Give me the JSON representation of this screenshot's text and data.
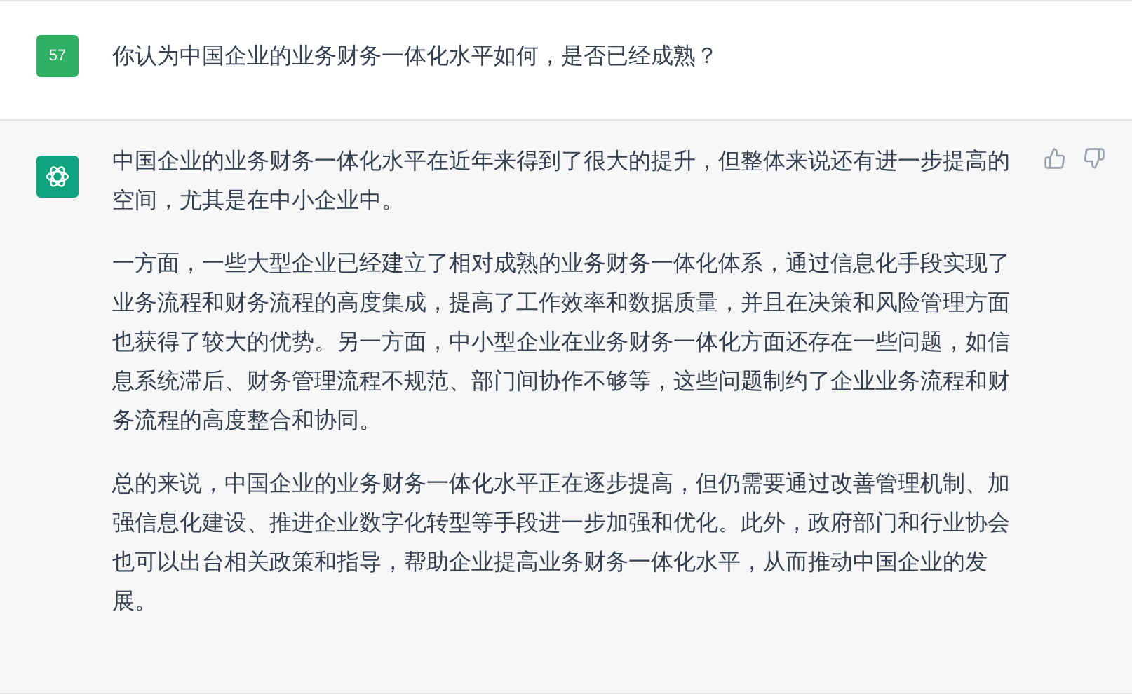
{
  "question": {
    "avatar": "57",
    "text": "你认为中国企业的业务财务一体化水平如何，是否已经成熟？"
  },
  "answer": {
    "paragraphs": [
      "中国企业的业务财务一体化水平在近年来得到了很大的提升，但整体来说还有进一步提高的空间，尤其是在中小企业中。",
      "一方面，一些大型企业已经建立了相对成熟的业务财务一体化体系，通过信息化手段实现了业务流程和财务流程的高度集成，提高了工作效率和数据质量，并且在决策和风险管理方面也获得了较大的优势。另一方面，中小型企业在业务财务一体化方面还存在一些问题，如信息系统滞后、财务管理流程不规范、部门间协作不够等，这些问题制约了企业业务流程和财务流程的高度整合和协同。",
      "总的来说，中国企业的业务财务一体化水平正在逐步提高，但仍需要通过改善管理机制、加强信息化建设、推进企业数字化转型等手段进一步加强和优化。此外，政府部门和行业协会也可以出台相关政策和指导，帮助企业提高业务财务一体化水平，从而推动中国企业的发展。"
    ]
  }
}
